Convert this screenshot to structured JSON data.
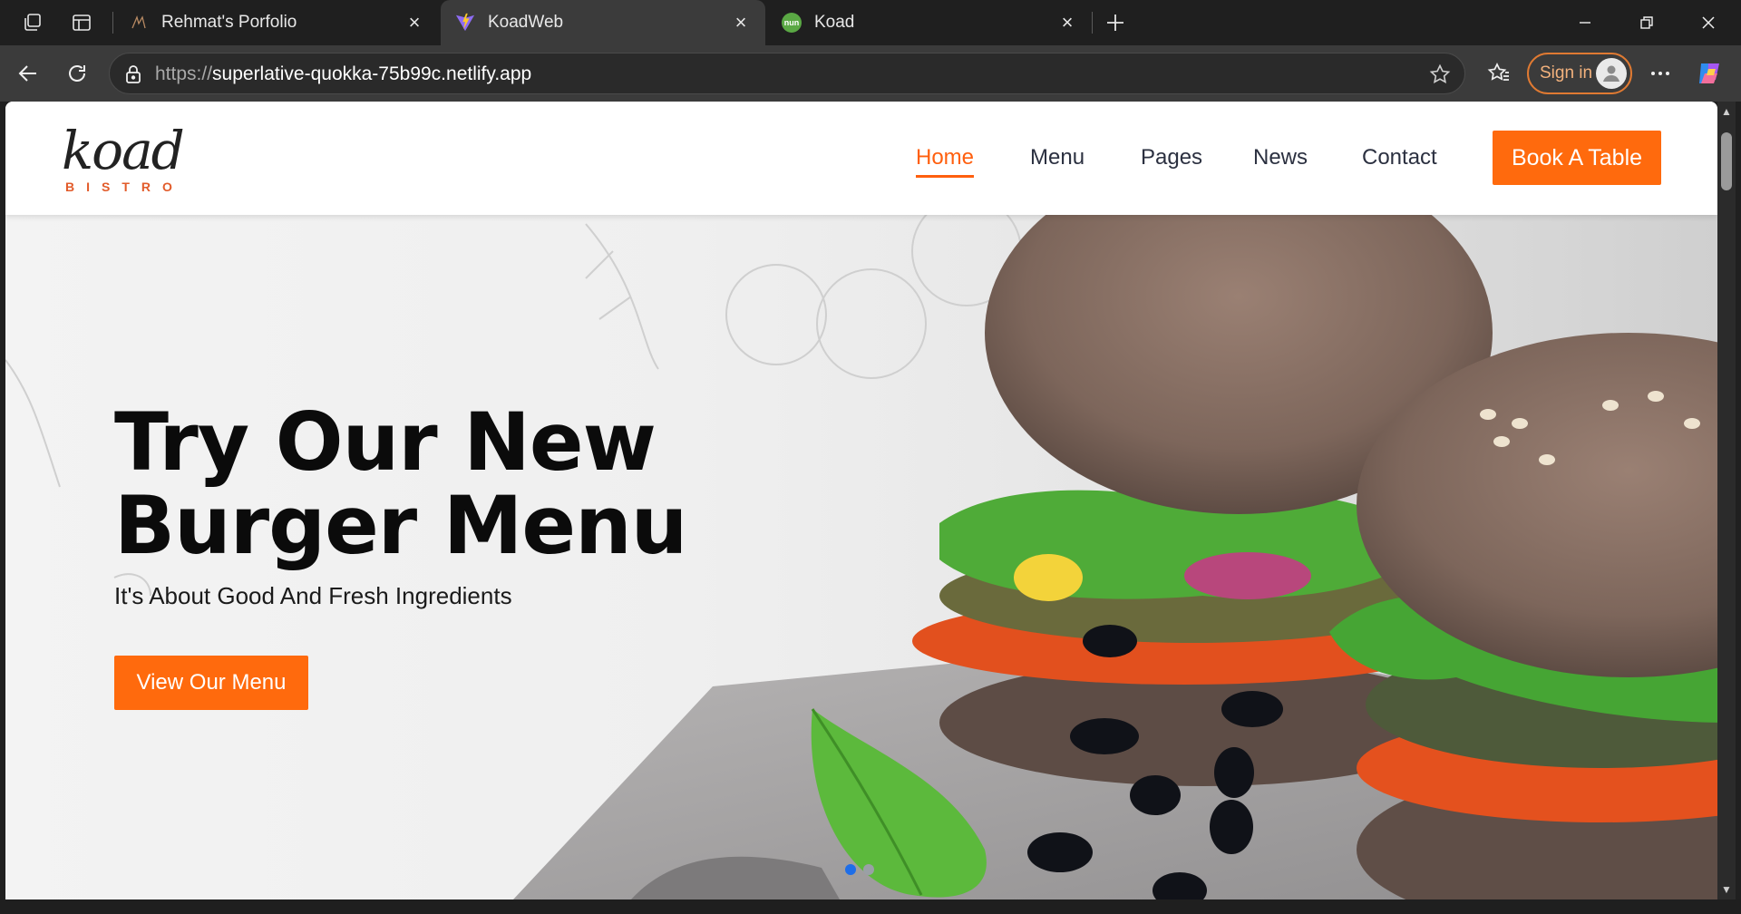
{
  "browser": {
    "tabs": [
      {
        "title": "Rehmat's Porfolio",
        "icon": "rk-logo-icon"
      },
      {
        "title": "KoadWeb",
        "icon": "vite-icon"
      },
      {
        "title": "Koad",
        "icon": "nuxt-icon",
        "favicon_text": "nun"
      }
    ],
    "active_tab": 1,
    "url_scheme": "https://",
    "url_host": "superlative-quokka-75b99c.netlify.app",
    "signin_label": "Sign in"
  },
  "site": {
    "logo": {
      "script": "koad",
      "sub": "BISTRO"
    },
    "nav": [
      {
        "label": "Home",
        "active": true
      },
      {
        "label": "Menu",
        "active": false
      },
      {
        "label": "Pages",
        "active": false
      },
      {
        "label": "News",
        "active": false
      },
      {
        "label": "Contact",
        "active": false
      }
    ],
    "cta_label": "Book A Table",
    "hero": {
      "title_line1": "Try Our New",
      "title_line2": "Burger Menu",
      "subtitle": "It's About Good And Fresh Ingredients",
      "button_label": "View Our Menu",
      "slides": 2,
      "active_slide": 0
    }
  },
  "colors": {
    "accent": "#ff6a0d",
    "chrome_dark": "#1f1f1f",
    "chrome_toolbar": "#3b3b3b",
    "signin_border": "#e07a32"
  }
}
